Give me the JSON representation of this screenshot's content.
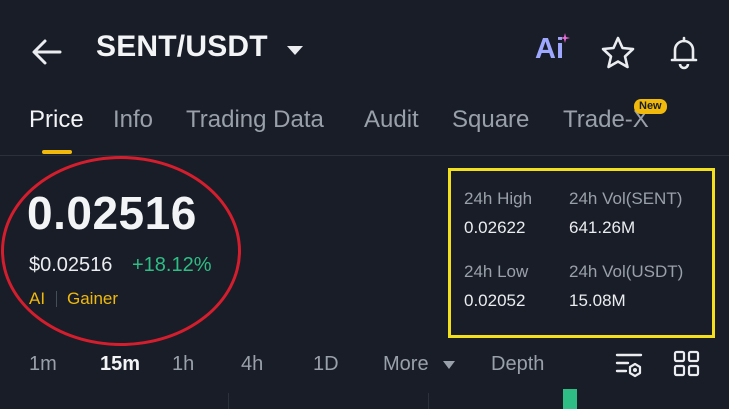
{
  "header": {
    "pair": "SENT/USDT",
    "ai_label": "Ai",
    "icons": [
      "back-arrow-icon",
      "dropdown-caret-icon",
      "ai-icon",
      "star-icon",
      "bell-icon"
    ]
  },
  "tabs": [
    {
      "label": "Price",
      "active": true
    },
    {
      "label": "Info"
    },
    {
      "label": "Trading Data"
    },
    {
      "label": "Audit"
    },
    {
      "label": "Square"
    },
    {
      "label": "Trade-X",
      "badge": "New"
    }
  ],
  "price": {
    "last": "0.02516",
    "usd": "$0.02516",
    "change": "+18.12%",
    "tags": [
      "AI",
      "Gainer"
    ]
  },
  "stats": {
    "high_label": "24h High",
    "high_value": "0.02622",
    "low_label": "24h Low",
    "low_value": "0.02052",
    "vol_base_label": "24h Vol(SENT)",
    "vol_base_value": "641.26M",
    "vol_quote_label": "24h Vol(USDT)",
    "vol_quote_value": "15.08M"
  },
  "intervals": {
    "items": [
      "1m",
      "15m",
      "1h",
      "4h",
      "1D",
      "More"
    ],
    "selected": "15m",
    "depth": "Depth"
  },
  "colors": {
    "background": "#181d27",
    "accent": "#f0b90b",
    "positive": "#2ebd85",
    "circle_annotation": "#d41e2d",
    "box_annotation": "#f2e01c"
  }
}
